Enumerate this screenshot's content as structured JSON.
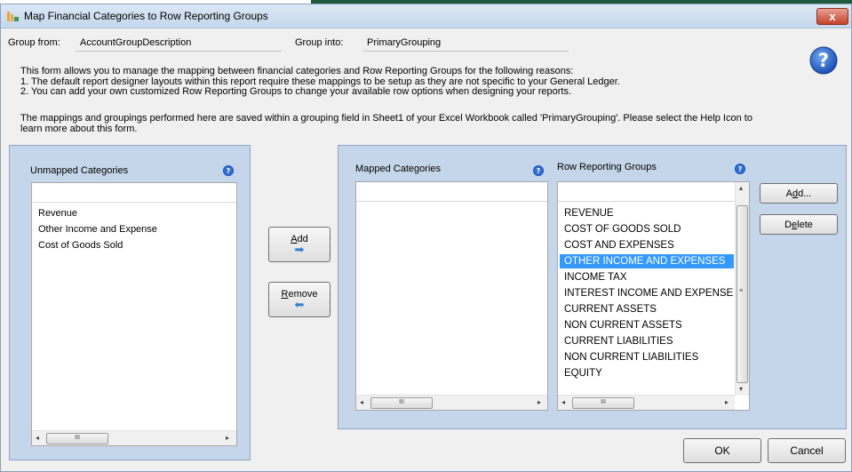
{
  "window": {
    "title": "Map Financial Categories to Row Reporting Groups",
    "close_glyph": "x"
  },
  "group": {
    "from_label": "Group from:",
    "from_value": "AccountGroupDescription",
    "into_label": "Group into:",
    "into_value": "PrimaryGrouping"
  },
  "description": {
    "line1": "This form allows you to manage the mapping between financial categories and Row Reporting Groups for the following reasons:",
    "line2": "1. The default report designer layouts within this report require these mappings to be setup as they are not specific to your General Ledger.",
    "line3": "2. You can add your own customized Row Reporting Groups to change your available row options when designing your reports.",
    "line4": "The mappings and groupings performed here are saved within a grouping field in Sheet1 of your Excel Workbook called 'PrimaryGrouping'. Please select the Help Icon to",
    "line5": "learn more about this form."
  },
  "unmapped": {
    "label": "Unmapped Categories",
    "items": [
      "Revenue",
      "Other Income and Expense",
      "Cost of Goods Sold"
    ]
  },
  "mapped": {
    "label": "Mapped Categories",
    "items": []
  },
  "row_groups": {
    "label": "Row Reporting Groups",
    "items": [
      "REVENUE",
      "COST OF GOODS SOLD",
      "COST AND EXPENSES",
      "OTHER INCOME AND EXPENSES",
      "INCOME TAX",
      "INTEREST INCOME AND EXPENSE",
      "CURRENT ASSETS",
      "NON CURRENT ASSETS",
      "CURRENT LIABILITIES",
      "NON CURRENT LIABILITIES",
      "EQUITY"
    ],
    "selected_index": 3
  },
  "buttons": {
    "add_transfer_u": "A",
    "add_transfer_rest": "dd",
    "remove_u": "R",
    "remove_rest": "emove",
    "add_group_pre": "A",
    "add_group_u": "d",
    "add_group_rest": "d...",
    "delete_pre": "D",
    "delete_u": "e",
    "delete_rest": "lete",
    "ok": "OK",
    "cancel": "Cancel"
  },
  "icons": {
    "help": "help-icon",
    "arrow_right": "right-arrow-icon",
    "arrow_left": "left-arrow-icon",
    "scrollbar_grip": "III"
  },
  "colors": {
    "panel": "#c6d6ea",
    "selection": "#3399ff",
    "help_blue": "#1e5fc4",
    "title_gradient_top": "#dbe7f5"
  }
}
